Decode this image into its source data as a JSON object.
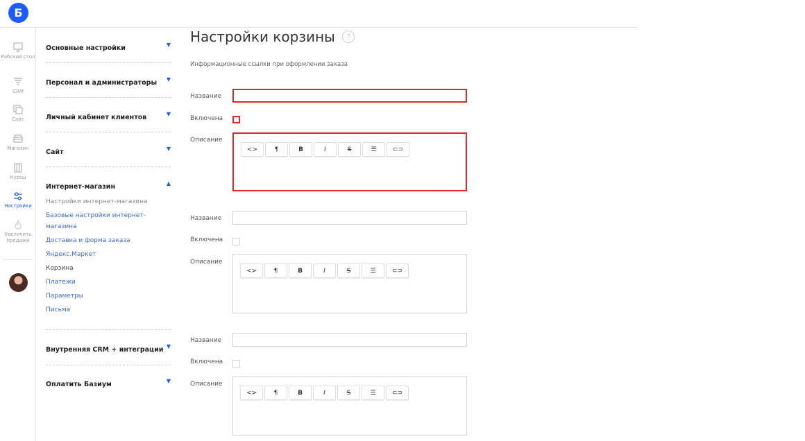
{
  "app": {
    "logo_letter": "Б",
    "brand_color": "#1a5cff",
    "error_color": "#e0262a"
  },
  "rail": {
    "items": [
      {
        "label": "Рабочий стол",
        "icon": "monitor-icon"
      },
      {
        "label": "CRM",
        "icon": "funnel-icon"
      },
      {
        "label": "Сайт",
        "icon": "site-icon"
      },
      {
        "label": "Магазин",
        "icon": "store-icon"
      },
      {
        "label": "Курсы",
        "icon": "courses-icon"
      },
      {
        "label": "Настройки",
        "icon": "sliders-icon",
        "active": true
      },
      {
        "label": "Увеличить продажи",
        "icon": "fire-icon"
      }
    ]
  },
  "menu": {
    "sections": [
      {
        "title": "Основные настройки",
        "arrow": "▼"
      },
      {
        "title": "Персонал и администраторы",
        "arrow": "▼"
      },
      {
        "title": "Личный кабинет клиентов",
        "arrow": "▼"
      },
      {
        "title": "Сайт",
        "arrow": "▼"
      },
      {
        "title": "Интернет-магазин",
        "arrow": "▲"
      },
      {
        "title": "Внутренняя CRM + интеграции",
        "arrow": "▼"
      },
      {
        "title": "Оплатить Базиум",
        "arrow": "▼"
      }
    ],
    "shop_items": [
      "Настройки интернет-магазина",
      "Базовые настройки интернет-магазина",
      "Доставка и форма заказа",
      "Яндекс.Маркет",
      "Корзина",
      "Платежи",
      "Параметры",
      "Письма"
    ]
  },
  "main": {
    "title": "Настройки корзины",
    "help": "?",
    "subtitle": "Информационные ссылки при оформлении заказа",
    "labels": {
      "name": "Название",
      "enabled": "Включена",
      "description": "Описание"
    },
    "toolbar": [
      "<>",
      "¶",
      "B",
      "I",
      "S",
      "☰",
      "⊂⊃"
    ],
    "link_blocks": [
      {
        "name_value": "",
        "enabled": false,
        "description": "",
        "error": true
      },
      {
        "name_value": "",
        "enabled": false,
        "description": "",
        "error": false
      },
      {
        "name_value": "",
        "enabled": false,
        "description": "",
        "error": false
      }
    ]
  }
}
